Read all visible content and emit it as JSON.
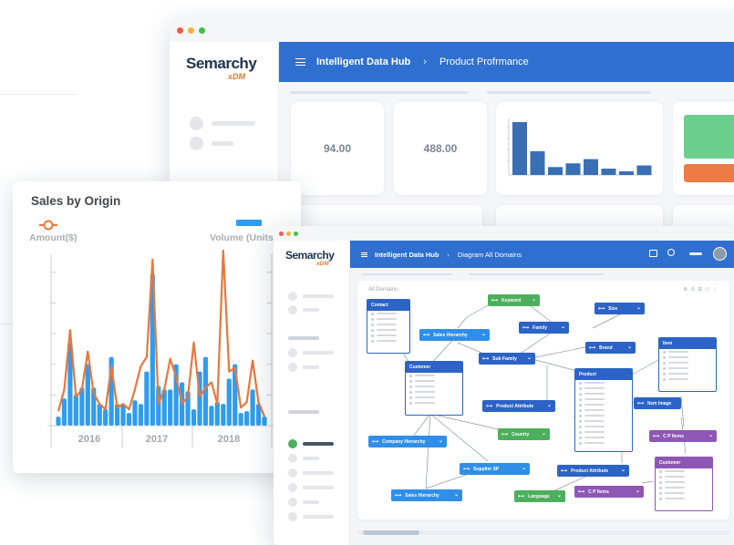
{
  "back_window": {
    "logo_text": "Semarchy",
    "logo_sub": "xDM",
    "breadcrumb": {
      "first": "Intelligent Data Hub",
      "separator": "›",
      "second": "Product Profrmance"
    },
    "kpis": [
      {
        "value": "94.00"
      },
      {
        "value": "488.00"
      }
    ],
    "mini_bar_values": [
      1.0,
      0.45,
      0.15,
      0.22,
      0.3,
      0.12,
      0.07,
      0.18
    ],
    "status_blocks": {
      "green": "#6ccf8d",
      "orange": "#ee7a45"
    }
  },
  "sales_card": {
    "title": "Sales by Origin",
    "legend_amount": "Amount($)",
    "legend_volume": "Volume (Units)",
    "colors": {
      "amount": "#e8773d",
      "volume": "#2f9cf0"
    },
    "chart_data": {
      "type": "bar",
      "categories_axis": [
        "2016",
        "2017",
        "2018"
      ],
      "x_points": 36,
      "series": [
        {
          "name": "Volume (Units)",
          "values": [
            0.05,
            0.15,
            0.46,
            0.17,
            0.21,
            0.34,
            0.21,
            0.12,
            0.09,
            0.38,
            0.12,
            0.12,
            0.07,
            0.14,
            0.12,
            0.3,
            0.84,
            0.22,
            0.2,
            0.2,
            0.34,
            0.24,
            0.19,
            0.09,
            0.3,
            0.38,
            0.11,
            0.13,
            0.12,
            0.26,
            0.34,
            0.07,
            0.08,
            0.2,
            0.12,
            0.05
          ]
        },
        {
          "name": "Amount($)",
          "values": [
            0.08,
            0.2,
            0.53,
            0.16,
            0.2,
            0.41,
            0.18,
            0.12,
            0.09,
            0.33,
            0.1,
            0.12,
            0.09,
            0.2,
            0.33,
            0.38,
            0.92,
            0.12,
            0.2,
            0.37,
            0.27,
            0.12,
            0.16,
            0.46,
            0.16,
            0.21,
            0.24,
            0.12,
            0.97,
            0.3,
            0.32,
            0.1,
            0.13,
            0.36,
            0.13,
            0.05
          ]
        }
      ],
      "ylim": [
        0,
        1
      ]
    }
  },
  "front_window": {
    "logo_text": "Semarchy",
    "logo_sub": "xDM",
    "breadcrumb": {
      "first": "Intelligent Data Hub",
      "separator": "›",
      "second": "Diagram All Domains"
    },
    "diagram_title": "All Domains",
    "nodes": {
      "keyword": "Keyword",
      "size": "Size",
      "family": "Family",
      "sales_hierarchy": "Sales Hierarchy",
      "brand": "Brand",
      "sub_family": "Sub Family",
      "item": "Item",
      "product_attribute": "Product Attribute",
      "item_image": "Item Image",
      "country": "Country",
      "cp_items_right": "C P Items",
      "company_hierarchy": "Company Hierarchy",
      "supplier_sp": "Supplier SP",
      "product_attribute2": "Product Attribute",
      "sales_hierarchy2": "Sales Hierarchy",
      "language": "Language",
      "cp_items": "C P Items"
    },
    "entities": {
      "contact": "Contact",
      "customer": "Customer",
      "product": "Product",
      "item": "Item",
      "customer2": "Customer"
    }
  }
}
